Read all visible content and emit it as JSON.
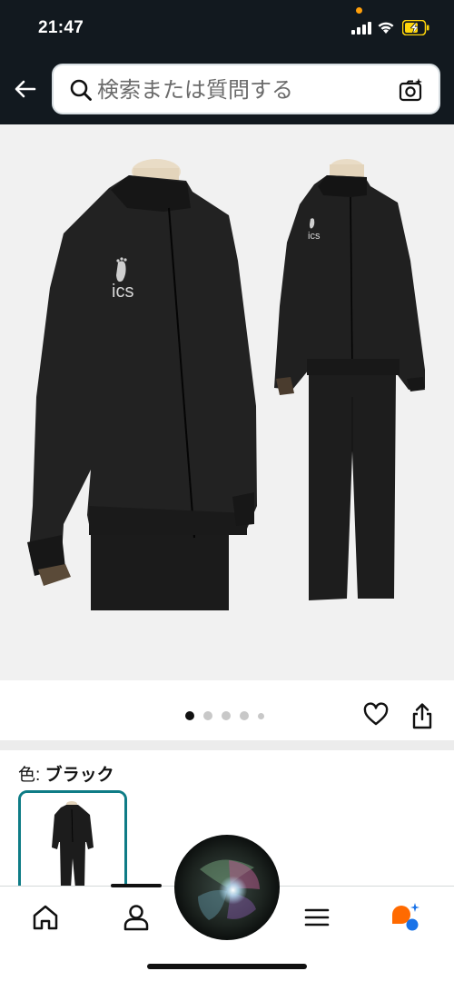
{
  "status_bar": {
    "time": "21:47"
  },
  "search": {
    "placeholder": "検索または質問する"
  },
  "gallery": {
    "page_count": 5,
    "active_index": 0,
    "image_description_icon": "tracksuit-product-photo",
    "logo_text": "ics"
  },
  "variation": {
    "label": "色: ",
    "value": "ブラック"
  },
  "icons": {
    "back": "arrow-left",
    "search": "magnifier",
    "camera": "camera-sparkle",
    "wishlist": "heart-outline",
    "share": "share-up-arrow",
    "nav_home": "home",
    "nav_account": "person",
    "nav_menu": "hamburger",
    "nav_rufus": "chat-bubble-sparkle"
  },
  "colors": {
    "header_bg": "#12191f",
    "accent_teal": "#0e7c86",
    "status_orange": "#ff9f0a",
    "battery_yellow": "#ffd60a",
    "rufus_orange": "#ff6a00",
    "rufus_blue": "#1a73e8"
  }
}
